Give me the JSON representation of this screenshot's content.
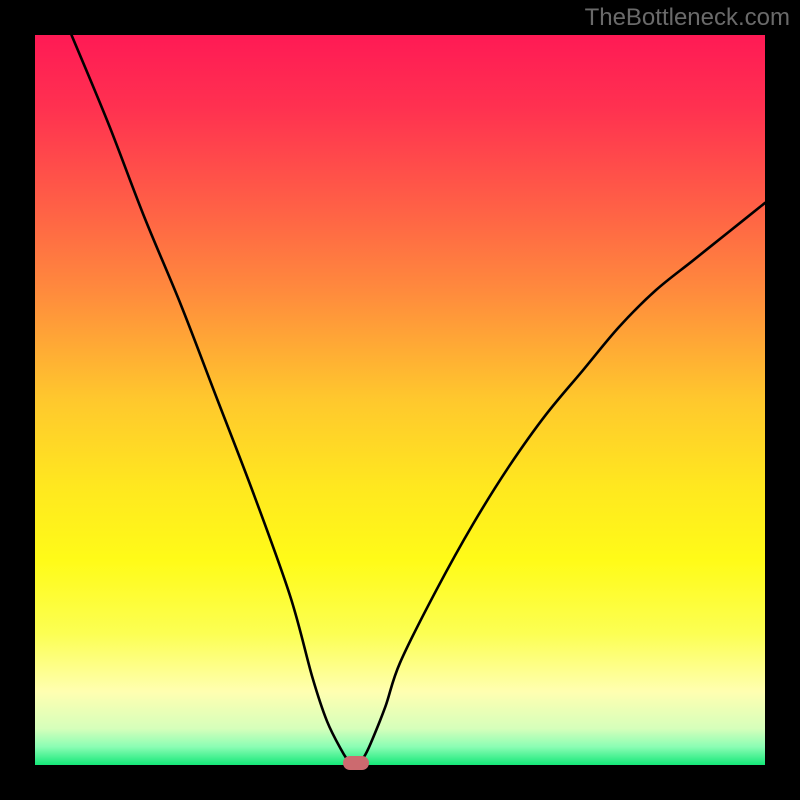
{
  "watermark": "TheBottleneck.com",
  "colors": {
    "frame": "#000000",
    "curve": "#000000",
    "marker": "#cc6a6f",
    "gradient_top": "#ff1a55",
    "gradient_bottom": "#14e878"
  },
  "chart_data": {
    "type": "line",
    "title": "",
    "xlabel": "",
    "ylabel": "",
    "xlim": [
      0,
      100
    ],
    "ylim": [
      0,
      100
    ],
    "x": [
      5,
      10,
      15,
      20,
      25,
      30,
      35,
      38,
      40,
      42,
      43,
      44,
      45,
      46,
      48,
      50,
      55,
      60,
      65,
      70,
      75,
      80,
      85,
      90,
      95,
      100
    ],
    "values": [
      100,
      88,
      75,
      63,
      50,
      37,
      23,
      12,
      6,
      2,
      0.5,
      0,
      1,
      3,
      8,
      14,
      24,
      33,
      41,
      48,
      54,
      60,
      65,
      69,
      73,
      77
    ],
    "minimum_at_x": 44,
    "marker": {
      "x": 44,
      "y": 0
    }
  }
}
